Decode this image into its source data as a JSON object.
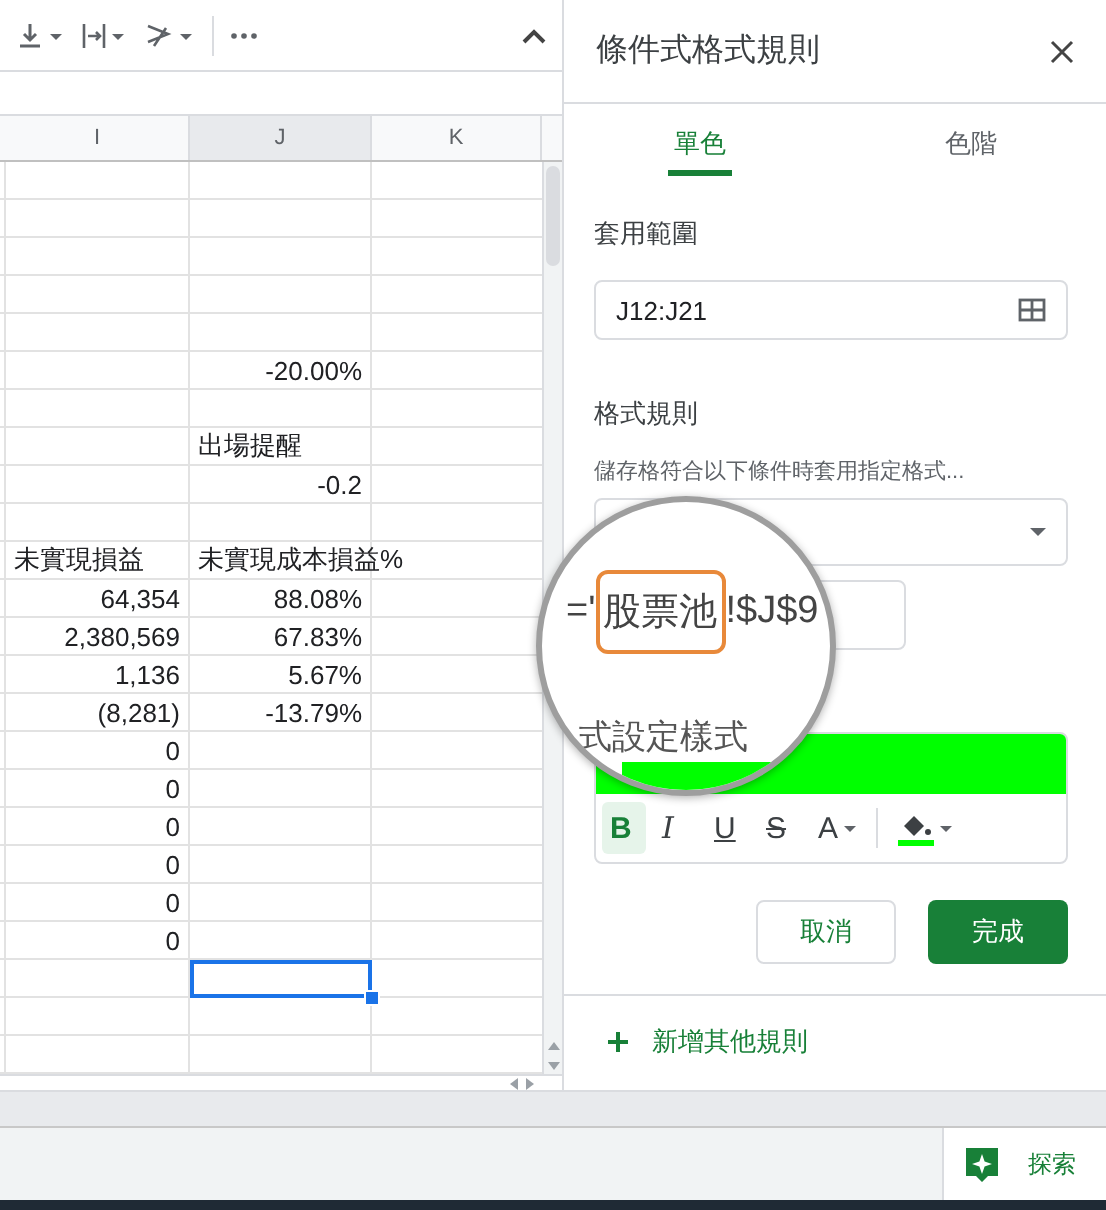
{
  "columns": [
    {
      "label": "I",
      "selected": false
    },
    {
      "label": "J",
      "selected": true
    },
    {
      "label": "K",
      "selected": false
    }
  ],
  "rows": [
    {
      "kind": "number",
      "selected": false
    },
    {
      "kind": "number",
      "selected": false
    },
    {
      "kind": "number",
      "selected": false
    },
    {
      "kind": "number",
      "selected": false
    },
    {
      "kind": "number",
      "selected": false
    },
    {
      "kind": "number",
      "j": "-20.00%",
      "selected": false
    },
    {
      "kind": "number",
      "selected": false
    },
    {
      "kind": "text",
      "j": "出場提醒",
      "selected": false
    },
    {
      "kind": "number",
      "j": "-0.2",
      "selected": false
    },
    {
      "kind": "number",
      "selected": false
    },
    {
      "kind": "text",
      "i": "未實現損益",
      "j": "未實現成本損益%",
      "selected": false
    },
    {
      "kind": "number",
      "i": "64,354",
      "j": "88.08%",
      "selected": false
    },
    {
      "kind": "number",
      "i": "2,380,569",
      "j": "67.83%",
      "selected": false
    },
    {
      "kind": "number",
      "i": "1,136",
      "j": "5.67%",
      "selected": false
    },
    {
      "kind": "number",
      "i": "(8,281)",
      "j": "-13.79%",
      "selected": false
    },
    {
      "kind": "number",
      "i": "0",
      "selected": false
    },
    {
      "kind": "number",
      "i": "0",
      "selected": false
    },
    {
      "kind": "number",
      "i": "0",
      "selected": false
    },
    {
      "kind": "number",
      "i": "0",
      "selected": false
    },
    {
      "kind": "number",
      "i": "0",
      "selected": false
    },
    {
      "kind": "number",
      "i": "0",
      "selected": false
    },
    {
      "kind": "number",
      "selected": true
    },
    {
      "kind": "number",
      "selected": false
    },
    {
      "kind": "number",
      "selected": false
    }
  ],
  "panel": {
    "title": "條件式格式規則",
    "tabs": [
      {
        "label": "單色",
        "selected": true
      },
      {
        "label": "色階",
        "selected": false
      }
    ],
    "range_label": "套用範圍",
    "range_value": "J12:J21",
    "rules_label": "格式規則",
    "rules_hint": "儲存格符合以下條件時套用指定格式...",
    "magnifier": {
      "formula_parts": [
        {
          "text": "='",
          "highlighted": false
        },
        {
          "text": "股票池",
          "highlighted": true
        },
        {
          "text": "!$J$9",
          "highlighted": false
        }
      ],
      "label": "式設定樣式"
    },
    "style_preview": {
      "color": "#00ff00"
    },
    "format_buttons": [
      {
        "kind": "bold",
        "label": "B",
        "selected": true
      },
      {
        "kind": "italic",
        "label": "I",
        "selected": false
      },
      {
        "kind": "underline",
        "label": "U",
        "selected": false
      },
      {
        "kind": "strike",
        "label": "S",
        "selected": false
      },
      {
        "kind": "text_color",
        "label": "A",
        "selected": false
      },
      {
        "kind": "fill",
        "selected": false
      }
    ],
    "buttons": [
      {
        "kind": "secondary",
        "label": "取消"
      },
      {
        "kind": "primary",
        "label": "完成"
      }
    ],
    "add_rule": "新增其他規則"
  },
  "explore_button": {
    "label": "探索"
  }
}
